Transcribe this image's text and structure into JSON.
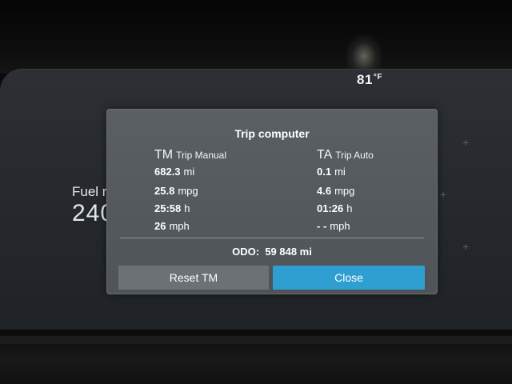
{
  "status": {
    "temperature_value": "81",
    "temperature_unit": "°F"
  },
  "background": {
    "fuel_range_label": "Fuel ra",
    "fuel_range_value": "240"
  },
  "dialog": {
    "title": "Trip computer",
    "columns": [
      {
        "abbr": "TM",
        "name": "Trip Manual",
        "rows": [
          {
            "value": "682.3",
            "unit": "mi"
          },
          {
            "value": "25.8",
            "unit": "mpg"
          },
          {
            "value": "25:58",
            "unit": "h"
          },
          {
            "value": "26",
            "unit": "mph"
          }
        ]
      },
      {
        "abbr": "TA",
        "name": "Trip Auto",
        "rows": [
          {
            "value": "0.1",
            "unit": "mi"
          },
          {
            "value": "4.6",
            "unit": "mpg"
          },
          {
            "value": "01:26",
            "unit": "h"
          },
          {
            "value": "- -",
            "unit": "mph"
          }
        ]
      }
    ],
    "odometer_label": "ODO:",
    "odometer_value": "59 848 mi",
    "buttons": {
      "reset_label": "Reset TM",
      "close_label": "Close",
      "close_color": "#2f9fd2"
    }
  }
}
